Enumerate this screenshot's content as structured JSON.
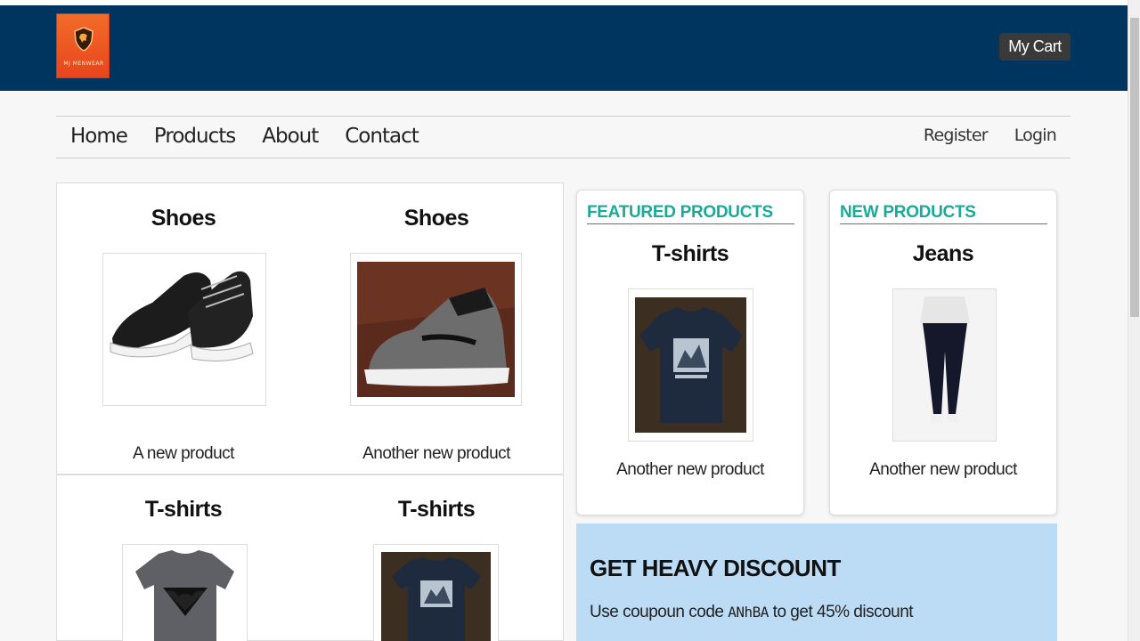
{
  "brand": {
    "logo_text": "MJ MENWEAR",
    "cart_label": "My Cart"
  },
  "nav": {
    "left": [
      "Home",
      "Products",
      "About",
      "Contact"
    ],
    "right": [
      "Register",
      "Login"
    ]
  },
  "grid": [
    {
      "title": "Shoes",
      "desc": "A new product",
      "image": "sneakers-photo"
    },
    {
      "title": "Shoes",
      "desc": "Another new product",
      "image": "high-top-shoe-photo"
    },
    {
      "title": "T-shirts",
      "desc": "",
      "image": "batman-superman-tshirt-photo"
    },
    {
      "title": "T-shirts",
      "desc": "",
      "image": "navy-tshirt-photo"
    }
  ],
  "featured": {
    "section": "FEATURED PRODUCTS",
    "title": "T-shirts",
    "desc": "Another new product",
    "image": "navy-tshirt-photo"
  },
  "new_products": {
    "section": "NEW PRODUCTS",
    "title": "Jeans",
    "desc": "Another new product",
    "image": "jeans-model-photo"
  },
  "discount": {
    "heading": "GET HEAVY DISCOUNT",
    "text_before": "Use coupoun code ",
    "code": "ANhBA",
    "text_after": " to get 45% discount"
  },
  "colors": {
    "header": "#003560",
    "accent": "#1ba99a",
    "discount_bg": "#bcdcf6"
  }
}
